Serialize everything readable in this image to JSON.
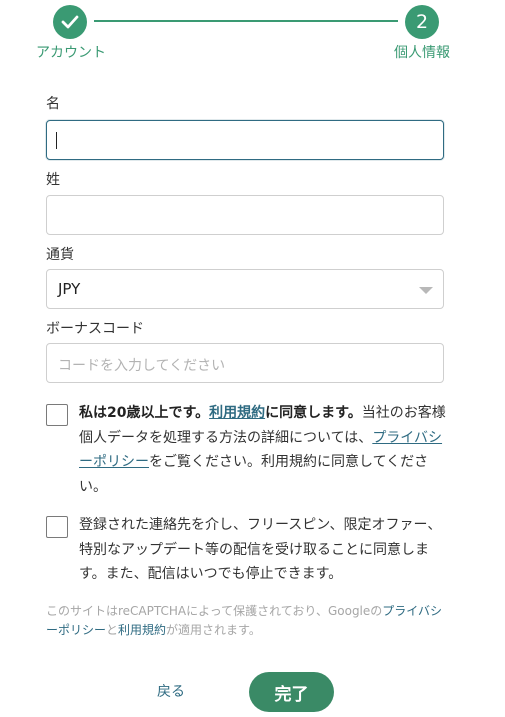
{
  "stepper": {
    "step1": {
      "label": "アカウント",
      "icon": "check-icon"
    },
    "step2": {
      "number": "2",
      "label": "個人情報"
    },
    "color": "#3a9a73"
  },
  "form": {
    "first_name": {
      "label": "名",
      "value": ""
    },
    "last_name": {
      "label": "姓",
      "value": ""
    },
    "currency": {
      "label": "通貨",
      "selected": "JPY"
    },
    "bonus_code": {
      "label": "ボーナスコード",
      "placeholder": "コードを入力してください"
    }
  },
  "consent_age": {
    "bold_before": "私は20歳以上です。",
    "terms_link": "利用規約",
    "bold_after": "に同意します。",
    "text1": "当社のお客様個人データを処理する方法の詳細については、",
    "privacy_link": "プライバシーポリシー",
    "text2": "をご覧ください。利用規約に同意してください。"
  },
  "consent_marketing": {
    "text": "登録された連絡先を介し、フリースピン、限定オファー、特別なアップデート等の配信を受け取ることに同意します。また、配信はいつでも停止できます。"
  },
  "recaptcha": {
    "text1": "このサイトはreCAPTCHAによって保護されており、Googleの",
    "privacy_link": "プライバシーポリシー",
    "text2": "と",
    "terms_link": "利用規約",
    "text3": "が適用されます。"
  },
  "buttons": {
    "back": "戻る",
    "complete": "完了"
  },
  "colors": {
    "accent": "#3a9a73",
    "link": "#2f6b82",
    "button": "#3a8a66"
  }
}
